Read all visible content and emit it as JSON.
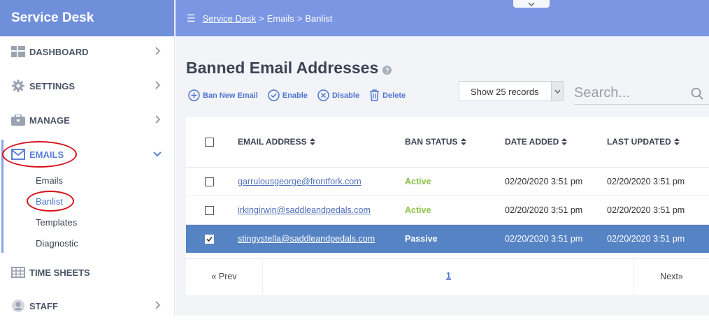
{
  "app": {
    "title": "Service Desk"
  },
  "breadcrumb": {
    "root": "Service Desk",
    "sep1": ">",
    "emails": "Emails",
    "sep2": ">",
    "current": "Banlist"
  },
  "sidebar": {
    "items": [
      {
        "label": "DASHBOARD",
        "icon": "dashboard-icon"
      },
      {
        "label": "SETTINGS",
        "icon": "gear-icon"
      },
      {
        "label": "MANAGE",
        "icon": "briefcase-icon"
      },
      {
        "label": "EMAILS",
        "icon": "envelope-icon"
      },
      {
        "label": "TIME SHEETS",
        "icon": "table-icon"
      },
      {
        "label": "STAFF",
        "icon": "user-icon"
      }
    ],
    "emails_sub": [
      "Emails",
      "Banlist",
      "Templates",
      "Diagnostic"
    ]
  },
  "main": {
    "title": "Banned Email Addresses",
    "actions": {
      "ban_new": "Ban New Email",
      "enable": "Enable",
      "disable": "Disable",
      "delete": "Delete"
    },
    "records_select": "Show 25 records",
    "search_placeholder": "Search..."
  },
  "table": {
    "headers": [
      "EMAIL ADDRESS",
      "BAN STATUS",
      "DATE ADDED",
      "LAST UPDATED"
    ],
    "rows": [
      {
        "email": "garrulousgeorge@frontfork.com",
        "status": "Active",
        "added": "02/20/2020 3:51 pm",
        "updated": "02/20/2020 3:51 pm",
        "checked": false
      },
      {
        "email": "irkingirwin@saddleandpedals.com",
        "status": "Active",
        "added": "02/20/2020 3:51 pm",
        "updated": "02/20/2020 3:51 pm",
        "checked": false
      },
      {
        "email": "stingystella@saddleandpedals.com",
        "status": "Passive",
        "added": "02/20/2020 3:51 pm",
        "updated": "02/20/2020 3:51 pm",
        "checked": true
      }
    ]
  },
  "pager": {
    "prev": "Prev",
    "page": "1",
    "next": "Next"
  },
  "colors": {
    "brand": "#6f8fda",
    "topbar": "#7b96e2",
    "selected_row": "#5583c4",
    "active_status": "#8bc34a",
    "annotation": "#d8121b"
  }
}
